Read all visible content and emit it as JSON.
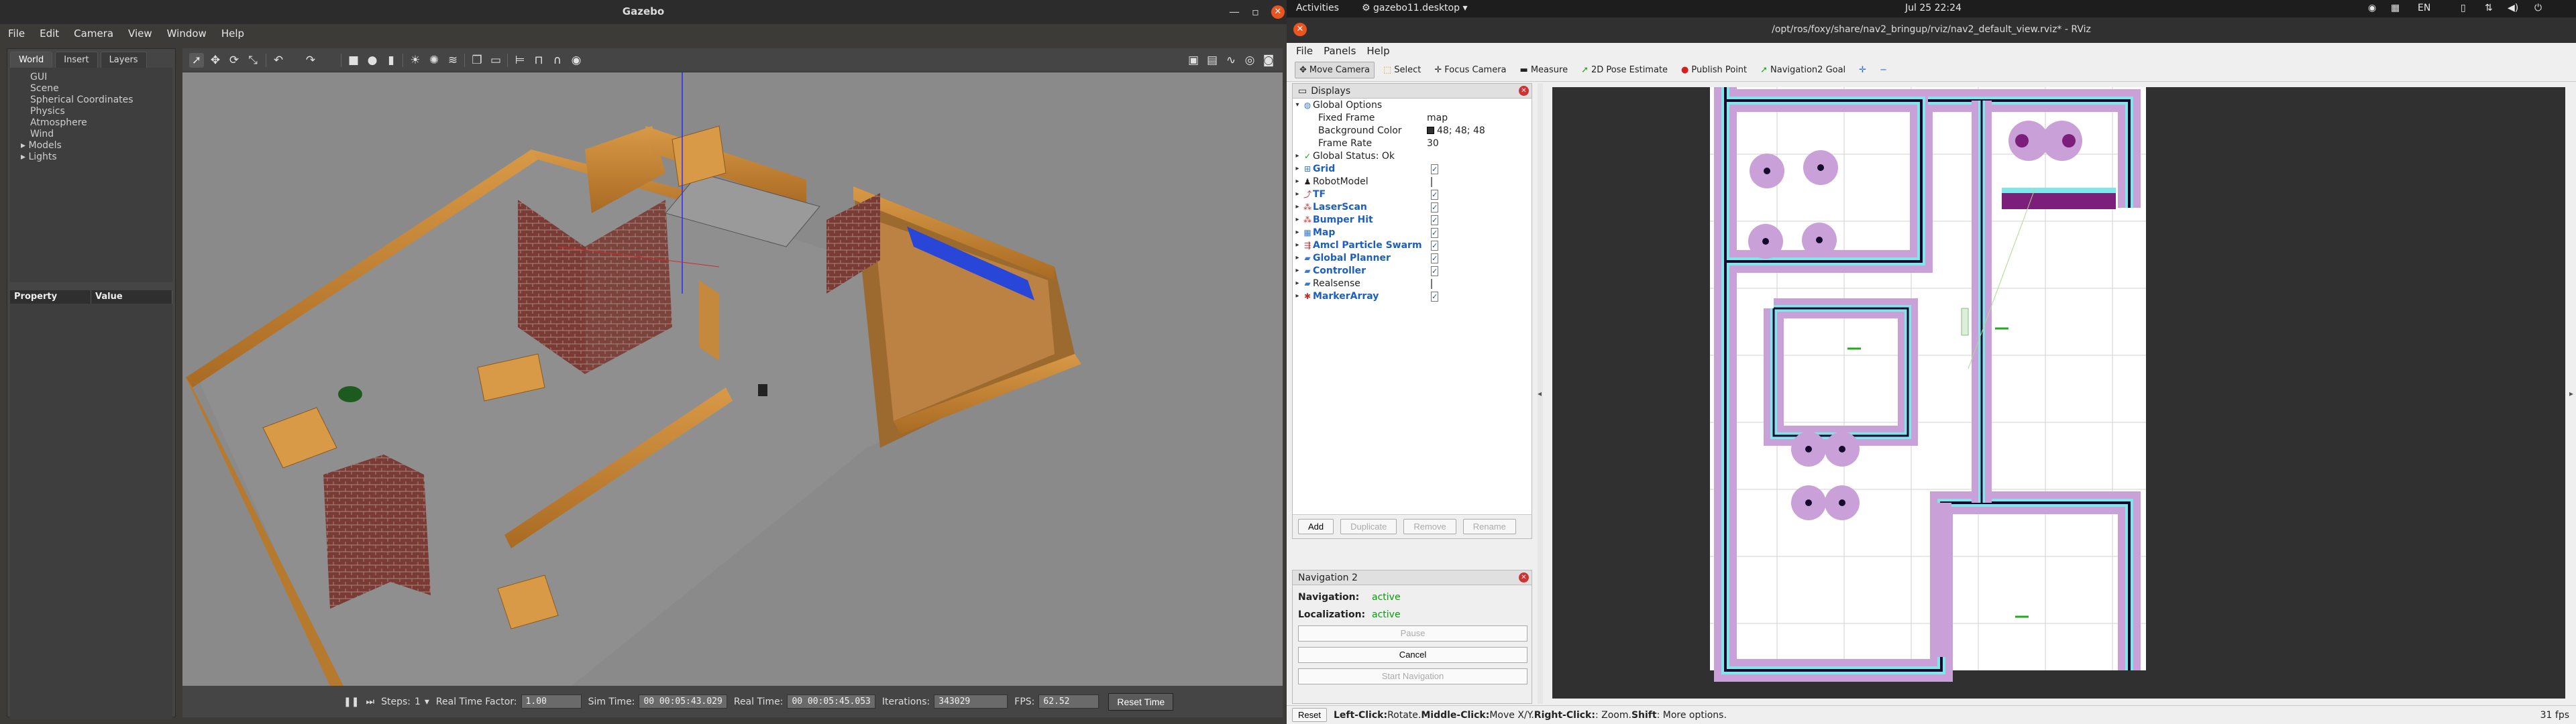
{
  "gazebo": {
    "window_title": "Gazebo",
    "menu": [
      "File",
      "Edit",
      "Camera",
      "View",
      "Window",
      "Help"
    ],
    "tabs": [
      "World",
      "Insert",
      "Layers"
    ],
    "tree_items": [
      "GUI",
      "Scene",
      "Spherical Coordinates",
      "Physics",
      "Atmosphere",
      "Wind",
      "Models",
      "Lights"
    ],
    "property_headers": [
      "Property",
      "Value"
    ],
    "bottom": {
      "steps_label": "Steps:",
      "steps_value": "1",
      "rtf_label": "Real Time Factor:",
      "rtf_value": "1.00",
      "sim_time_label": "Sim Time:",
      "sim_time_value": "00 00:05:43.029",
      "real_time_label": "Real Time:",
      "real_time_value": "00 00:05:45.053",
      "iterations_label": "Iterations:",
      "iterations_value": "343029",
      "fps_label": "FPS:",
      "fps_value": "62.52",
      "reset_label": "Reset Time"
    }
  },
  "topbar": {
    "activities": "Activities",
    "app_name": "gazebo11.desktop",
    "clock": "Jul 25  22:24",
    "lang": "EN"
  },
  "rviz": {
    "window_title": "/opt/ros/foxy/share/nav2_bringup/rviz/nav2_default_view.rviz* - RViz",
    "menu": [
      "File",
      "Panels",
      "Help"
    ],
    "toolbar": [
      "Move Camera",
      "Select",
      "Focus Camera",
      "Measure",
      "2D Pose Estimate",
      "Publish Point",
      "Navigation2 Goal"
    ],
    "displays_title": "Displays",
    "global_options": "Global Options",
    "fixed_frame_label": "Fixed Frame",
    "fixed_frame_value": "map",
    "bg_color_label": "Background Color",
    "bg_color_value": "48; 48; 48",
    "frame_rate_label": "Frame Rate",
    "frame_rate_value": "30",
    "global_status": "Global Status: Ok",
    "displays": [
      "Grid",
      "RobotModel",
      "TF",
      "LaserScan",
      "Bumper Hit",
      "Map",
      "Amcl Particle Swarm",
      "Global Planner",
      "Controller",
      "Realsense",
      "MarkerArray"
    ],
    "buttons": [
      "Add",
      "Duplicate",
      "Remove",
      "Rename"
    ],
    "nav2": {
      "title": "Navigation 2",
      "navigation_label": "Navigation:",
      "navigation_value": "active",
      "localization_label": "Localization:",
      "localization_value": "active",
      "pause": "Pause",
      "cancel": "Cancel",
      "start": "Start Navigation"
    },
    "status": {
      "reset": "Reset",
      "left": "Left-Click:",
      "left_t": " Rotate. ",
      "middle": "Middle-Click:",
      "middle_t": " Move X/Y. ",
      "right": "Right-Click:",
      "right_t": ": Zoom. ",
      "shift": "Shift",
      "shift_t": ": More options.",
      "fps": "31 fps"
    },
    "colors": {
      "background": "#303030",
      "costmap_inflation": "#c9a0d8",
      "costmap_core": "#7fe7ea",
      "costmap_lethal": "#7b1f7a",
      "walls": "#150a2e"
    }
  }
}
